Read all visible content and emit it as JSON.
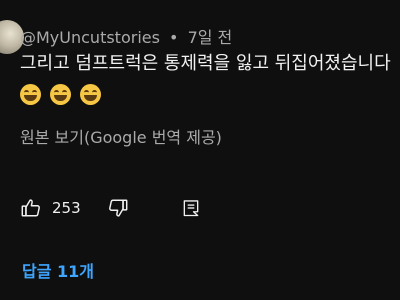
{
  "comment": {
    "author": "@MyUncutstories",
    "separator": "•",
    "time": "7일 전",
    "text": "그리고 덤프트럭은 통제력을 잃고 뒤집어졌습니다",
    "emojis": [
      "grinning-squinting-face",
      "grinning-squinting-face",
      "grinning-squinting-face"
    ],
    "translate_link": "원본 보기(Google 번역 제공)"
  },
  "actions": {
    "like_count": "253",
    "like_icon": "thumbs-up-icon",
    "dislike_icon": "thumbs-down-icon",
    "reply_icon": "reply-icon"
  },
  "replies": {
    "label": "답글 11개"
  },
  "colors": {
    "background": "#0f0f0f",
    "text": "#f1f1f1",
    "secondary_text": "#aaaaaa",
    "link": "#3ea6ff"
  }
}
